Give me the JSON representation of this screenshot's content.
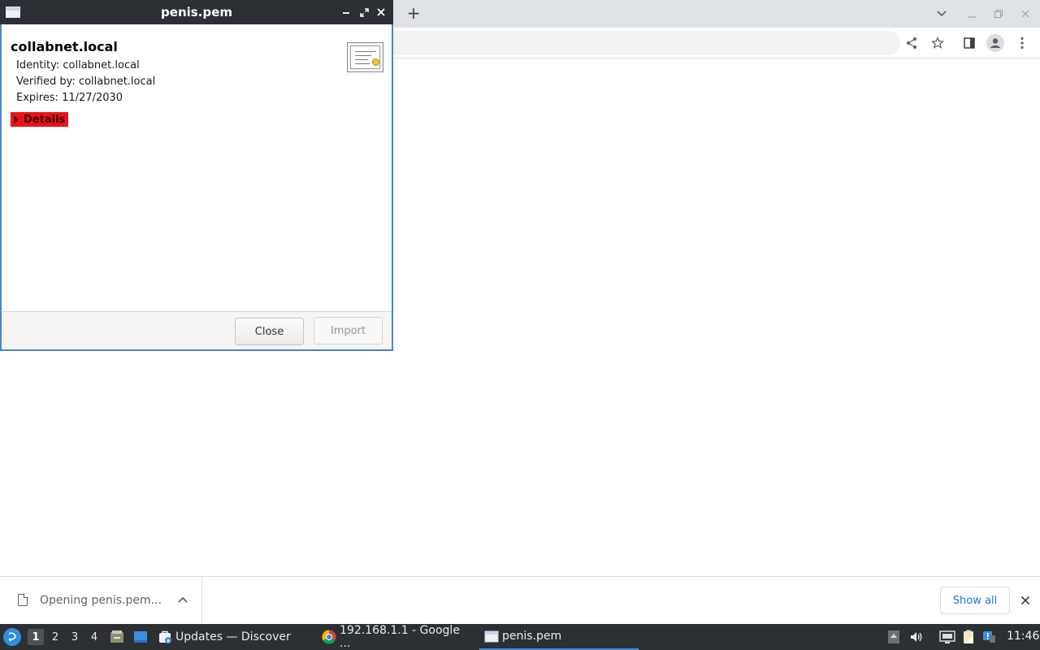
{
  "dialog": {
    "title": "penis.pem",
    "common_name": "collabnet.local",
    "identity": "Identity: collabnet.local",
    "verified_by": "Verified by: collabnet.local",
    "expires": "Expires: 11/27/2030",
    "details_label": "Details",
    "close_label": "Close",
    "import_label": "Import"
  },
  "browser": {
    "new_tab_symbol": "+"
  },
  "download_shelf": {
    "item_label": "Opening penis.pem...",
    "show_all_label": "Show all"
  },
  "taskbar": {
    "desktops": [
      "1",
      "2",
      "3",
      "4"
    ],
    "tasks": [
      {
        "label": "Updates — Discover",
        "icon": "discover-icon"
      },
      {
        "label": "192.168.1.1 - Google ...",
        "icon": "chrome-icon"
      },
      {
        "label": "penis.pem",
        "icon": "window-icon"
      }
    ],
    "clock": "11:46"
  },
  "colors": {
    "dialog_border": "#4a86c8",
    "details_highlight": "#e8141b",
    "taskbar_bg": "#2c3033",
    "link_blue": "#1a73e8"
  }
}
